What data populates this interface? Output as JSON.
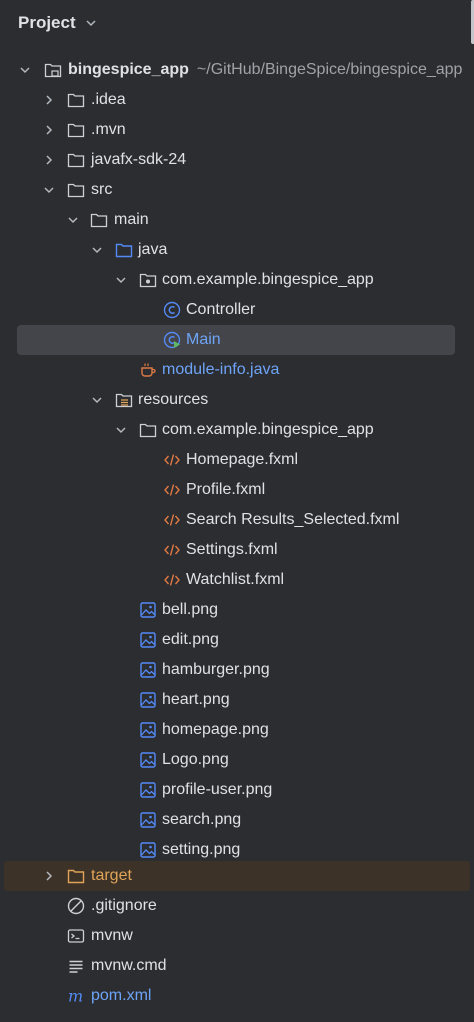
{
  "header": {
    "title": "Project"
  },
  "tree": {
    "root": {
      "name": "bingespice_app",
      "path": "~/GitHub/BingeSpice/bingespice_app"
    },
    "idea": ".idea",
    "mvn": ".mvn",
    "javafx": "javafx-sdk-24",
    "src": "src",
    "main": "main",
    "java": "java",
    "java_pkg": "com.example.bingespice_app",
    "controller": "Controller",
    "main_class": "Main",
    "module_info": "module-info.java",
    "resources": "resources",
    "res_pkg": "com.example.bingespice_app",
    "fxml": [
      "Homepage.fxml",
      "Profile.fxml",
      "Search Results_Selected.fxml",
      "Settings.fxml",
      "Watchlist.fxml"
    ],
    "pngs": [
      "bell.png",
      "edit.png",
      "hamburger.png",
      "heart.png",
      "homepage.png",
      "Logo.png",
      "profile-user.png",
      "search.png",
      "setting.png"
    ],
    "target": "target",
    "gitignore": ".gitignore",
    "mvnw": "mvnw",
    "mvnw_cmd": "mvnw.cmd",
    "pom": "pom.xml"
  },
  "colors": {
    "background": "#2b2d30",
    "selection": "#43454a",
    "excluded": "#3d3228",
    "text": "#dfe1e5",
    "link_blue": "#6ea4f7",
    "folder_blue": "#548af7",
    "fxml_orange": "#e07a45",
    "target_orange": "#e0a458"
  }
}
